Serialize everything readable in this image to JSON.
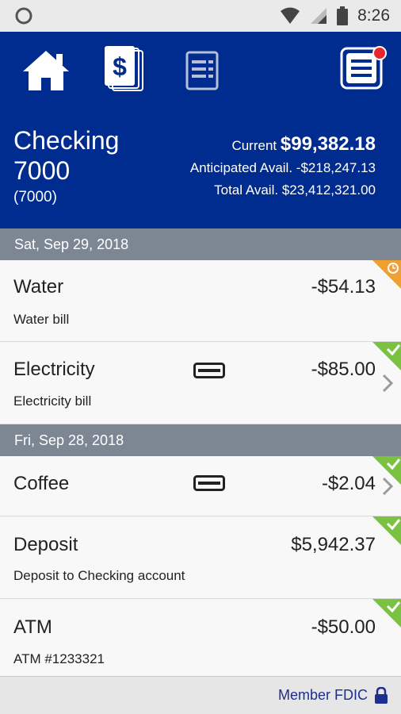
{
  "status_bar": {
    "time": "8:26",
    "icons": [
      "notification-circle-icon",
      "wifi-icon",
      "cell-signal-icon",
      "battery-icon"
    ]
  },
  "nav": {
    "items": [
      "home-icon",
      "money-icon",
      "statement-icon",
      "menu-icon"
    ],
    "menu_has_notification": true
  },
  "account": {
    "name": "Checking 7000",
    "number": "(7000)",
    "current_label": "Current",
    "current_value": "$99,382.18",
    "anticipated_label": "Anticipated Avail.",
    "anticipated_value": "-$218,247.13",
    "total_label": "Total Avail.",
    "total_value": "$23,412,321.00"
  },
  "groups": [
    {
      "date": "Sat, Sep 29, 2018",
      "transactions": [
        {
          "title": "Water",
          "subtitle": "Water bill",
          "amount": "-$54.13",
          "status": "pending"
        },
        {
          "title": "Electricity",
          "subtitle": "Electricity bill",
          "amount": "-$85.00",
          "status": "cleared"
        }
      ]
    },
    {
      "date": "Fri, Sep 28, 2018",
      "transactions": [
        {
          "title": "Coffee",
          "amount": "-$2.04",
          "status": "cleared"
        },
        {
          "title": "Deposit",
          "subtitle": "Deposit to Checking account",
          "amount": "$5,942.37",
          "status": "cleared"
        },
        {
          "title": "ATM",
          "subtitle": "ATM #1233321",
          "amount": "-$50.00",
          "status": "cleared"
        }
      ]
    }
  ],
  "footer": {
    "text": "Member FDIC"
  },
  "colors": {
    "header": "#002b8f",
    "date_header": "#7d8794",
    "cleared": "#7cc242",
    "pending": "#f0a030",
    "notification": "#e8262d"
  }
}
